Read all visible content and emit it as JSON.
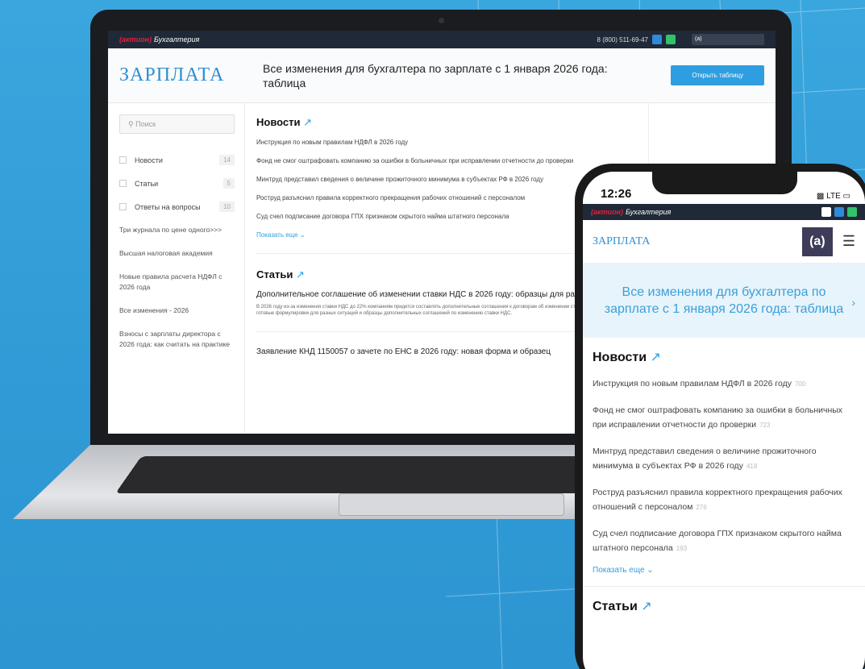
{
  "laptop": {
    "topbar": {
      "logo_brand": "(актион)",
      "logo_product": "Бухгалтерия",
      "phone": "8 (800) 511-69-47",
      "search_text": "(a)"
    },
    "hero": {
      "brand": "ЗАРПЛАТА",
      "title": "Все изменения для бухгалтера по зарплате с 1 января 2026 года: таблица",
      "button": "Открыть таблицу"
    },
    "sidebar": {
      "search_placeholder": "Поиск",
      "items": [
        {
          "label": "Новости",
          "count": "14"
        },
        {
          "label": "Статьи",
          "count": "5"
        },
        {
          "label": "Ответы на вопросы",
          "count": "10"
        }
      ],
      "links": [
        "Три журнала по цене одного>>>",
        "Высшая налоговая академия",
        "Новые правила расчета НДФЛ с 2026 года",
        "Все изменения - 2026",
        "Взносы с зарплаты директора с 2026 года: как считать на практике"
      ]
    },
    "main": {
      "news_heading": "Новости",
      "news": [
        "Инструкция по новым правилам НДФЛ в 2026 году",
        "Фонд не смог оштрафовать компанию за ошибки в больничных при исправлении отчетности до проверки",
        "Минтруд представил сведения о величине прожиточного минимума в субъектах РФ в 2026 году",
        "Роструд разъяснил правила корректного прекращения рабочих отношений с персоналом",
        "Суд счел подписание договора ГПХ признаком скрытого найма штатного персонала"
      ],
      "more": "Показать еще",
      "articles_heading": "Статьи",
      "articles": [
        {
          "title": "Дополнительное соглашение об изменении ставки НДС в 2026 году: образцы для разных ситуаций",
          "body": "В 2026 году из-за изменения ставки НДС до 22% компаниям придется составлять дополнительные соглашения к договорам об изменении ставки. В статье привели готовые формулировки для разных ситуаций и образцы дополнительных соглашений по изменению ставки НДС."
        },
        {
          "title": "Заявление КНД 1150057 о зачете по ЕНС в 2026 году: новая форма и образец",
          "body": ""
        }
      ]
    }
  },
  "phone": {
    "time": "12:26",
    "signal": "LTE",
    "topbar": {
      "logo_brand": "(актион)",
      "logo_product": "Бухгалтерия"
    },
    "brand": "ЗАРПЛАТА",
    "logo_mark": "(a)",
    "hero_title": "Все изменения для бухгалтера по зарплате с 1 января 2026 года: таблица",
    "news_heading": "Новости",
    "news": [
      {
        "text": "Инструкция по новым правилам НДФЛ в 2026 году",
        "views": "700"
      },
      {
        "text": "Фонд не смог оштрафовать компанию за ошибки в больничных при исправлении отчетности до проверки",
        "views": "723"
      },
      {
        "text": "Минтруд представил сведения о величине прожиточного минимума в субъектах РФ в 2026 году",
        "views": "418"
      },
      {
        "text": "Роструд разъяснил правила корректного прекращения рабочих отношений с персоналом",
        "views": "276"
      },
      {
        "text": "Суд счел подписание договора ГПХ признаком скрытого найма штатного персонала",
        "views": "193"
      }
    ],
    "more": "Показать еще",
    "articles_heading": "Статьи"
  },
  "colors": {
    "background": "#2f9fd8",
    "accent": "#2f9ee0",
    "brand": "#2f8fd1",
    "logo_red": "#e2233b"
  }
}
